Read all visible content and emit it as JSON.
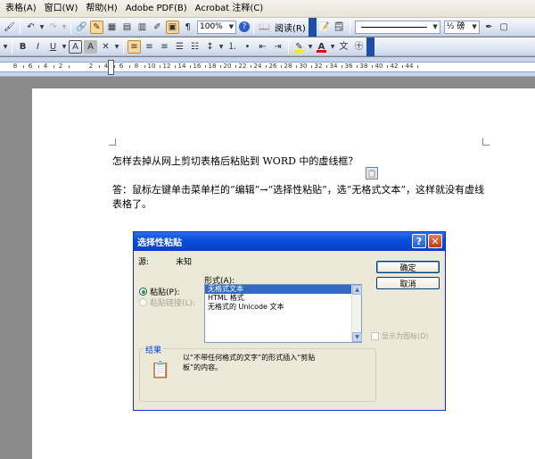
{
  "menu": [
    "表格(A)",
    "窗口(W)",
    "帮助(H)",
    "Adobe PDF(B)",
    "Acrobat 注释(C)"
  ],
  "toolbar": {
    "zoom": "100%",
    "read_button": "阅读(R)",
    "font_size_combo": "½ 磅",
    "bold": "B",
    "italic": "I",
    "underline": "U",
    "char_shade": "A",
    "char_border": "A"
  },
  "ruler": {
    "labels": [
      "8",
      "6",
      "4",
      "2",
      "2",
      "4",
      "6",
      "8",
      "10",
      "12",
      "14",
      "16",
      "18",
      "20",
      "22",
      "24",
      "26",
      "28",
      "30",
      "32",
      "34",
      "36",
      "38",
      "40",
      "42",
      "44"
    ]
  },
  "document": {
    "question": "怎样去掉从网上剪切表格后粘贴到 WORD 中的虚线框？",
    "answer_line1": "答：鼠标左键单击菜单栏的“编辑”→“选择性粘贴”，选“无格式文本”，这样就没有虚线",
    "answer_line2": "表格了。"
  },
  "dialog": {
    "title": "选择性粘贴",
    "help": "?",
    "close": "✕",
    "source_label": "源:",
    "source_value": "未知",
    "format_label": "形式(A):",
    "radio_paste": "粘贴(P):",
    "radio_paste_link": "粘贴链接(L):",
    "formats": [
      "无格式文本",
      "HTML 格式",
      "无格式的 Unicode 文本"
    ],
    "ok": "确定",
    "cancel": "取消",
    "show_as_icon": "显示为图标(D)",
    "result_label": "结果",
    "result_line1": "以“不带任何格式的文字”的形式插入“剪贴",
    "result_line2": "板”的内容。"
  }
}
